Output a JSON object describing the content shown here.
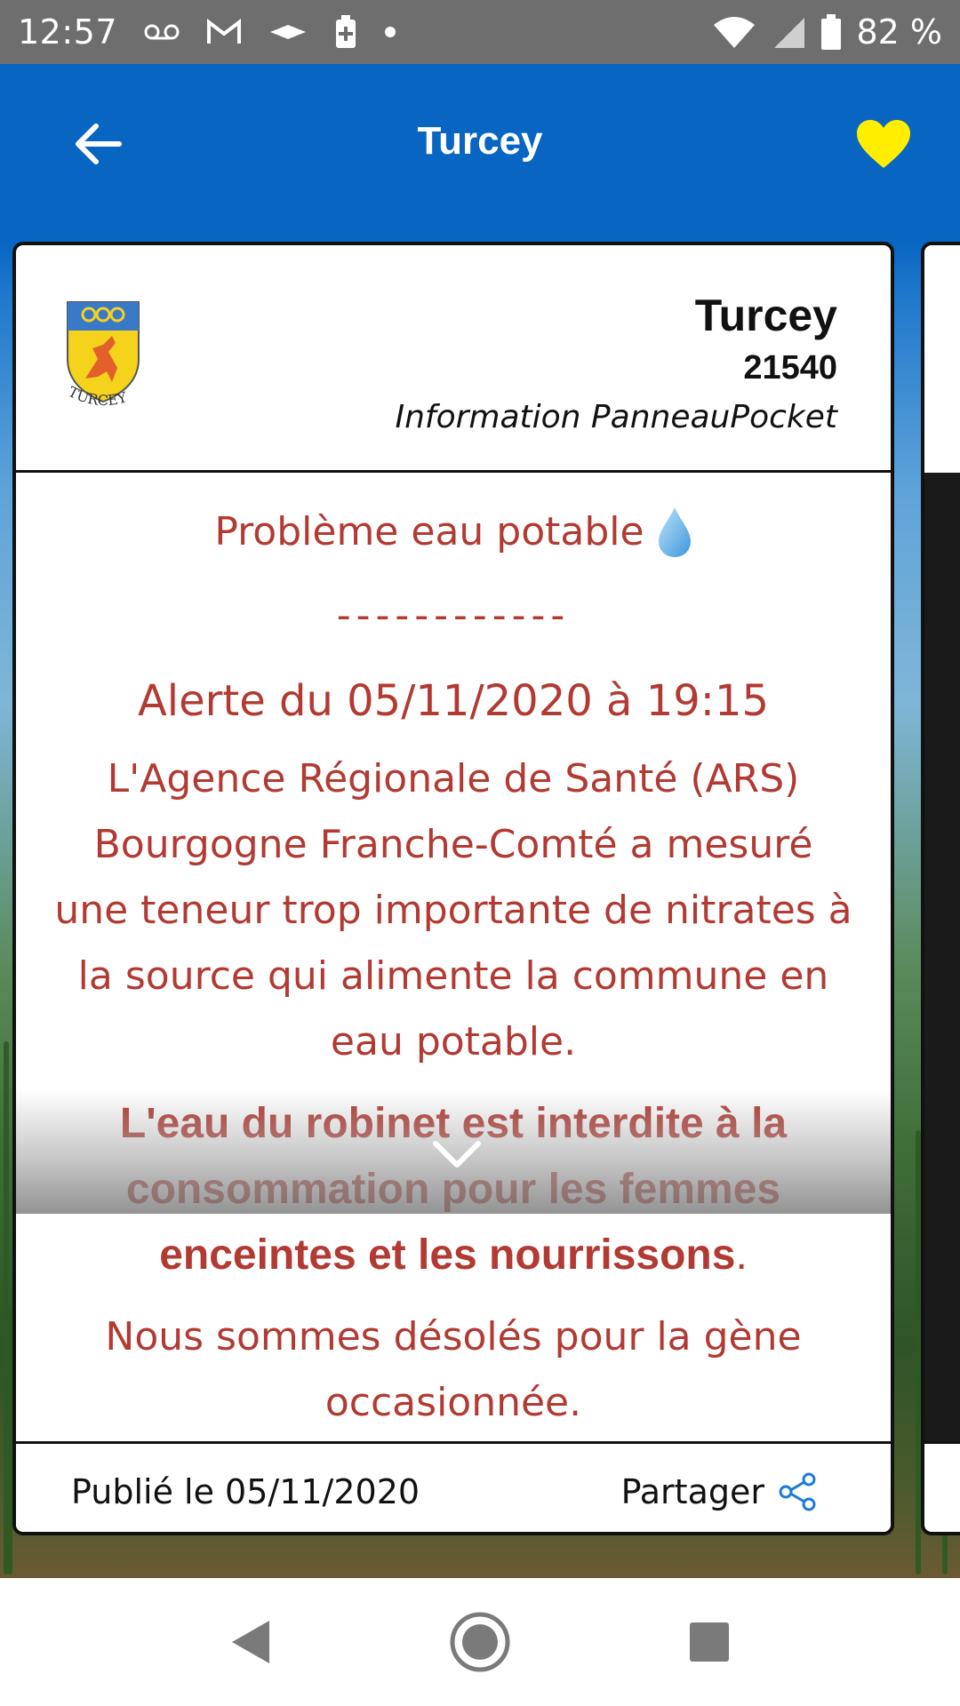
{
  "status_bar": {
    "time": "12:57",
    "battery": "82 %"
  },
  "header": {
    "title": "Turcey",
    "accent_color": "#0866c2",
    "favorite_color": "#ffee00"
  },
  "card": {
    "town": "Turcey",
    "postal_code": "21540",
    "source": "Information PanneauPocket",
    "crest_text": "TURCEY",
    "message": {
      "title": "Problème eau potable",
      "separator": "------------",
      "alert": "Alerte du 05/11/2020 à 19:15",
      "paragraph": "L'Agence Régionale de Santé (ARS) Bourgogne Franche-Comté a mesuré une teneur trop importante de nitrates à la source qui alimente la commune en eau potable.",
      "warning": "L'eau du robinet est interdite à la consommation pour les femmes enceintes et les nourrissons",
      "warning_end": ".",
      "apology": "Nous sommes désolés pour la gène occasionnée.",
      "text_color": "#b23a33"
    },
    "published": "Publié le 05/11/2020",
    "share_label": "Partager"
  },
  "icons": {
    "back": "arrow-left-icon",
    "favorite": "heart-icon",
    "drop": "water-drop-icon",
    "expand": "chevron-down-icon",
    "share": "share-icon"
  }
}
